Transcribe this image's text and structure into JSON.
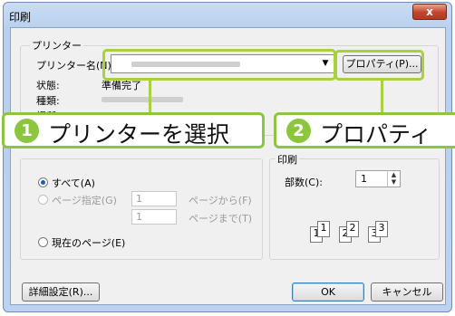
{
  "window": {
    "title": "印刷",
    "close_glyph": "x"
  },
  "printer": {
    "group_label": "プリンター",
    "name_label": "プリンター名(N):",
    "properties_button": "プロパティ(P)...",
    "status_label": "状態:",
    "status_value": "準備完了",
    "type_label": "種類:",
    "location_label": "場所:"
  },
  "range": {
    "all_label": "すべて(A)",
    "pages_label": "ページ指定(G)",
    "from_value": "1",
    "from_label": "ページから(F)",
    "to_value": "1",
    "to_label": "ページまで(T)",
    "current_label": "現在のページ(E)"
  },
  "copies": {
    "group_label": "印刷",
    "count_label": "部数(C):",
    "count_value": "1",
    "collate_glyphs": [
      "1",
      "1",
      "2",
      "2",
      "3",
      "3"
    ]
  },
  "buttons": {
    "advanced": "詳細設定(R)...",
    "ok": "OK",
    "cancel": "キャンセル"
  },
  "callouts": [
    {
      "number": "1",
      "text": "プリンターを選択"
    },
    {
      "number": "2",
      "text": "プロパティ"
    }
  ],
  "colors": {
    "accent_green": "#8cc63e",
    "highlight_green": "#a9d13b",
    "title_bar": "#bcd2ef"
  }
}
